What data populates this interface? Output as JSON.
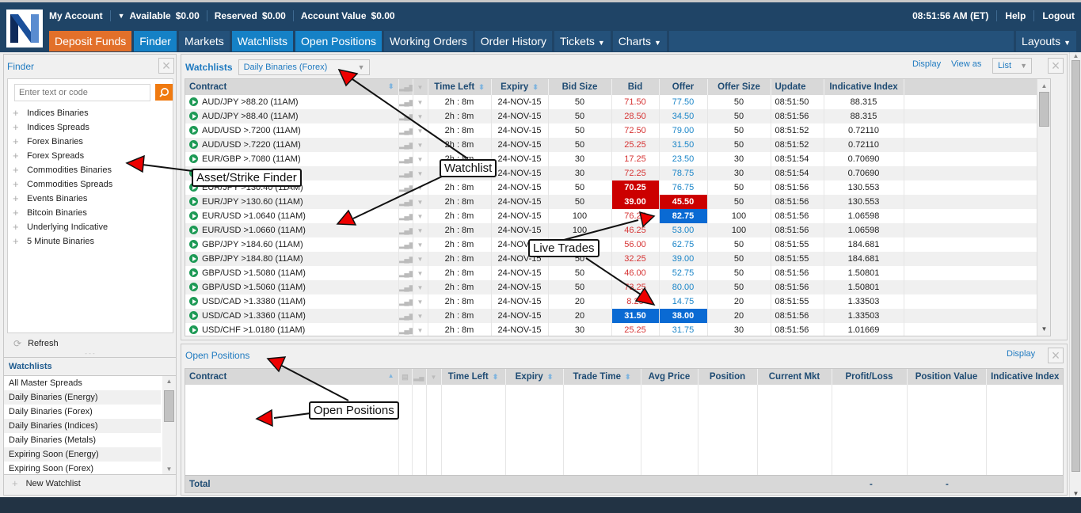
{
  "header": {
    "my_account": "My Account",
    "available_label": "Available",
    "available_value": "$0.00",
    "reserved_label": "Reserved",
    "reserved_value": "$0.00",
    "account_value_label": "Account Value",
    "account_value_value": "$0.00",
    "clock": "08:51:56 AM (ET)",
    "help": "Help",
    "logout": "Logout"
  },
  "nav": {
    "deposit": "Deposit Funds",
    "finder": "Finder",
    "markets": "Markets",
    "watchlists": "Watchlists",
    "open_positions": "Open Positions",
    "working_orders": "Working Orders",
    "order_history": "Order History",
    "tickets": "Tickets",
    "charts": "Charts",
    "layouts": "Layouts"
  },
  "finder": {
    "title": "Finder",
    "search_placeholder": "Enter text or code",
    "items": [
      "Indices Binaries",
      "Indices Spreads",
      "Forex Binaries",
      "Forex Spreads",
      "Commodities Binaries",
      "Commodities Spreads",
      "Events Binaries",
      "Bitcoin Binaries",
      "Underlying Indicative",
      "5 Minute Binaries"
    ],
    "refresh": "Refresh"
  },
  "watchlists_panel": {
    "title": "Watchlists",
    "items": [
      "All Master Spreads",
      "Daily Binaries (Energy)",
      "Daily Binaries (Forex)",
      "Daily Binaries (Indices)",
      "Daily Binaries (Metals)",
      "Expiring Soon (Energy)",
      "Expiring Soon (Forex)"
    ],
    "new_watchlist": "New Watchlist"
  },
  "watchlist": {
    "title": "Watchlists",
    "selected": "Daily Binaries (Forex)",
    "display": "Display",
    "view_as_label": "View as",
    "view_as_value": "List",
    "columns": [
      "Contract",
      "Time Left",
      "Expiry",
      "Bid Size",
      "Bid",
      "Offer",
      "Offer Size",
      "Update",
      "Indicative Index"
    ],
    "rows": [
      {
        "contract": "AUD/JPY >88.20 (11AM)",
        "time_left": "2h : 8m",
        "expiry": "24-NOV-15",
        "bid_size": "50",
        "bid": "71.50",
        "offer": "77.50",
        "offer_size": "50",
        "update": "08:51:50",
        "index": "88.315",
        "bid_hl": "",
        "offer_hl": ""
      },
      {
        "contract": "AUD/JPY >88.40 (11AM)",
        "time_left": "2h : 8m",
        "expiry": "24-NOV-15",
        "bid_size": "50",
        "bid": "28.50",
        "offer": "34.50",
        "offer_size": "50",
        "update": "08:51:56",
        "index": "88.315",
        "bid_hl": "",
        "offer_hl": ""
      },
      {
        "contract": "AUD/USD >.7200 (11AM)",
        "time_left": "2h : 8m",
        "expiry": "24-NOV-15",
        "bid_size": "50",
        "bid": "72.50",
        "offer": "79.00",
        "offer_size": "50",
        "update": "08:51:52",
        "index": "0.72110",
        "bid_hl": "",
        "offer_hl": ""
      },
      {
        "contract": "AUD/USD >.7220 (11AM)",
        "time_left": "2h : 8m",
        "expiry": "24-NOV-15",
        "bid_size": "50",
        "bid": "25.25",
        "offer": "31.50",
        "offer_size": "50",
        "update": "08:51:52",
        "index": "0.72110",
        "bid_hl": "",
        "offer_hl": ""
      },
      {
        "contract": "EUR/GBP >.7080 (11AM)",
        "time_left": "2h : 8m",
        "expiry": "24-NOV-15",
        "bid_size": "30",
        "bid": "17.25",
        "offer": "23.50",
        "offer_size": "30",
        "update": "08:51:54",
        "index": "0.70690",
        "bid_hl": "",
        "offer_hl": ""
      },
      {
        "contract": "EUR/GBP >.7060 (11AM)",
        "time_left": "2h : 8m",
        "expiry": "24-NOV-15",
        "bid_size": "30",
        "bid": "72.25",
        "offer": "78.75",
        "offer_size": "30",
        "update": "08:51:54",
        "index": "0.70690",
        "bid_hl": "",
        "offer_hl": ""
      },
      {
        "contract": "EUR/JPY >130.40 (11AM)",
        "time_left": "2h : 8m",
        "expiry": "24-NOV-15",
        "bid_size": "50",
        "bid": "70.25",
        "offer": "76.75",
        "offer_size": "50",
        "update": "08:51:56",
        "index": "130.553",
        "bid_hl": "red",
        "offer_hl": ""
      },
      {
        "contract": "EUR/JPY >130.60 (11AM)",
        "time_left": "2h : 8m",
        "expiry": "24-NOV-15",
        "bid_size": "50",
        "bid": "39.00",
        "offer": "45.50",
        "offer_size": "50",
        "update": "08:51:56",
        "index": "130.553",
        "bid_hl": "red",
        "offer_hl": "red"
      },
      {
        "contract": "EUR/USD >1.0640 (11AM)",
        "time_left": "2h : 8m",
        "expiry": "24-NOV-15",
        "bid_size": "100",
        "bid": "76.25",
        "offer": "82.75",
        "offer_size": "100",
        "update": "08:51:56",
        "index": "1.06598",
        "bid_hl": "",
        "offer_hl": "blue"
      },
      {
        "contract": "EUR/USD >1.0660 (11AM)",
        "time_left": "2h : 8m",
        "expiry": "24-NOV-15",
        "bid_size": "100",
        "bid": "46.25",
        "offer": "53.00",
        "offer_size": "100",
        "update": "08:51:56",
        "index": "1.06598",
        "bid_hl": "",
        "offer_hl": ""
      },
      {
        "contract": "GBP/JPY >184.60 (11AM)",
        "time_left": "2h : 8m",
        "expiry": "24-NOV-15",
        "bid_size": "50",
        "bid": "56.00",
        "offer": "62.75",
        "offer_size": "50",
        "update": "08:51:55",
        "index": "184.681",
        "bid_hl": "",
        "offer_hl": ""
      },
      {
        "contract": "GBP/JPY >184.80 (11AM)",
        "time_left": "2h : 8m",
        "expiry": "24-NOV-15",
        "bid_size": "50",
        "bid": "32.25",
        "offer": "39.00",
        "offer_size": "50",
        "update": "08:51:55",
        "index": "184.681",
        "bid_hl": "",
        "offer_hl": ""
      },
      {
        "contract": "GBP/USD >1.5080 (11AM)",
        "time_left": "2h : 8m",
        "expiry": "24-NOV-15",
        "bid_size": "50",
        "bid": "46.00",
        "offer": "52.75",
        "offer_size": "50",
        "update": "08:51:56",
        "index": "1.50801",
        "bid_hl": "",
        "offer_hl": ""
      },
      {
        "contract": "GBP/USD >1.5060 (11AM)",
        "time_left": "2h : 8m",
        "expiry": "24-NOV-15",
        "bid_size": "50",
        "bid": "73.25",
        "offer": "80.00",
        "offer_size": "50",
        "update": "08:51:56",
        "index": "1.50801",
        "bid_hl": "",
        "offer_hl": ""
      },
      {
        "contract": "USD/CAD >1.3380 (11AM)",
        "time_left": "2h : 8m",
        "expiry": "24-NOV-15",
        "bid_size": "20",
        "bid": "8.25",
        "offer": "14.75",
        "offer_size": "20",
        "update": "08:51:55",
        "index": "1.33503",
        "bid_hl": "",
        "offer_hl": ""
      },
      {
        "contract": "USD/CAD >1.3360 (11AM)",
        "time_left": "2h : 8m",
        "expiry": "24-NOV-15",
        "bid_size": "20",
        "bid": "31.50",
        "offer": "38.00",
        "offer_size": "20",
        "update": "08:51:56",
        "index": "1.33503",
        "bid_hl": "blue",
        "offer_hl": "blue"
      },
      {
        "contract": "USD/CHF >1.0180 (11AM)",
        "time_left": "2h : 8m",
        "expiry": "24-NOV-15",
        "bid_size": "30",
        "bid": "25.25",
        "offer": "31.75",
        "offer_size": "30",
        "update": "08:51:56",
        "index": "1.01669",
        "bid_hl": "",
        "offer_hl": ""
      }
    ]
  },
  "open_positions": {
    "title": "Open Positions",
    "display": "Display",
    "columns": [
      "Contract",
      "Time Left",
      "Expiry",
      "Trade Time",
      "Avg Price",
      "Position",
      "Current Mkt",
      "Profit/Loss",
      "Position Value",
      "Indicative Index"
    ],
    "total_label": "Total",
    "total_profit_loss": "-",
    "total_position_value": "-"
  },
  "annotations": {
    "finder": "Asset/Strike Finder",
    "watchlist": "Watchlist",
    "live_trades": "Live Trades",
    "open_positions": "Open Positions"
  },
  "colors": {
    "header_bg": "#1f4466",
    "deposit": "#e2702a",
    "active_tab": "#1581c6",
    "bid": "#d63333",
    "offer": "#1a85c8",
    "highlight_red": "#cc0000",
    "highlight_blue": "#0a6ad3"
  }
}
